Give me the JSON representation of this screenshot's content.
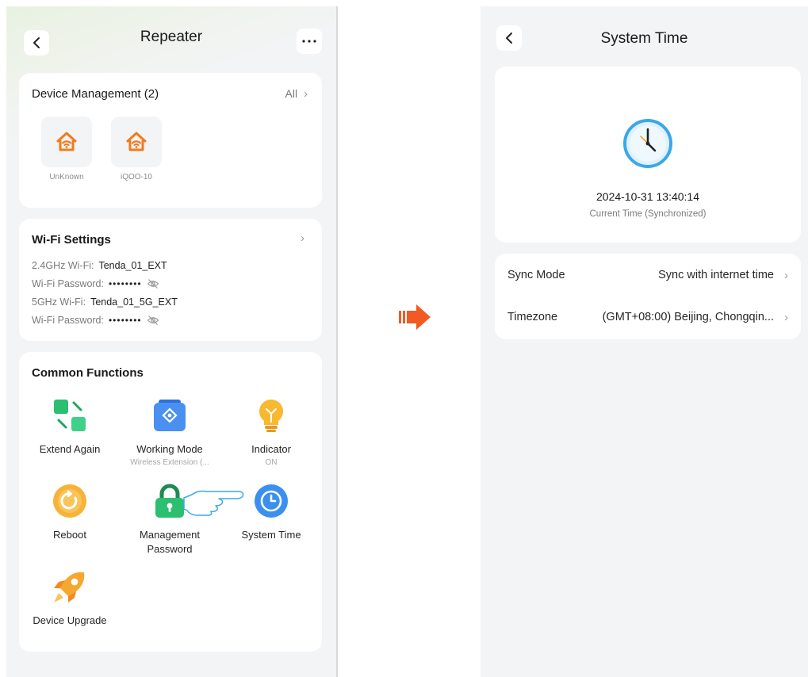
{
  "left": {
    "title": "Repeater",
    "device_management": {
      "title": "Device Management (2)",
      "all_label": "All",
      "devices": [
        {
          "name": "UnKnown",
          "icon": "house-wifi-icon"
        },
        {
          "name": "iQOO-10",
          "icon": "house-wifi-icon"
        }
      ]
    },
    "wifi_settings": {
      "title": "Wi-Fi Settings",
      "lines": [
        {
          "label": "2.4GHz Wi-Fi:",
          "value": "Tenda_01_EXT"
        },
        {
          "label": "Wi-Fi Password:",
          "value": "••••••••"
        },
        {
          "label": "5GHz Wi-Fi:",
          "value": "Tenda_01_5G_EXT"
        },
        {
          "label": "Wi-Fi Password:",
          "value": "••••••••"
        }
      ]
    },
    "common_functions": {
      "title": "Common Functions",
      "items": [
        {
          "label": "Extend Again",
          "sub": ""
        },
        {
          "label": "Working Mode",
          "sub": "Wireless Extension (..."
        },
        {
          "label": "Indicator",
          "sub": "ON"
        },
        {
          "label": "Reboot",
          "sub": ""
        },
        {
          "label": "Management Password",
          "sub": ""
        },
        {
          "label": "System Time",
          "sub": ""
        },
        {
          "label": "Device Upgrade",
          "sub": ""
        }
      ]
    }
  },
  "right": {
    "title": "System Time",
    "datetime": "2024-10-31 13:40:14",
    "status": "Current Time (Synchronized)",
    "rows": [
      {
        "key": "Sync Mode",
        "value": "Sync with internet time"
      },
      {
        "key": "Timezone",
        "value": "(GMT+08:00) Beijing, Chongqin..."
      }
    ]
  },
  "colors": {
    "accent_orange": "#f07b1c",
    "arrow": "#f15a22",
    "clock_blue": "#3aa8e8",
    "green": "#2bbf71"
  }
}
